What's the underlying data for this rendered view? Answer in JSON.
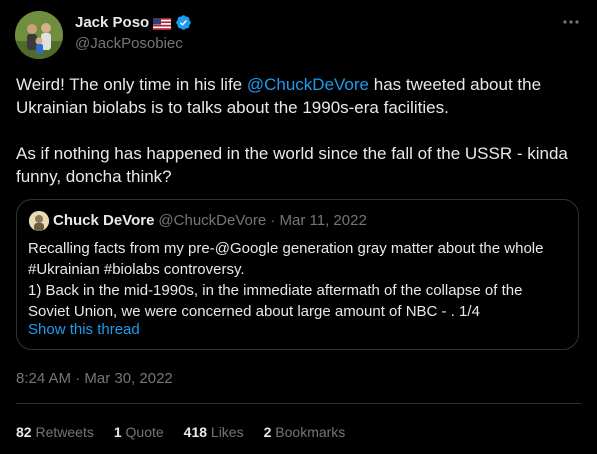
{
  "author": {
    "name": "Jack Poso",
    "handle": "@JackPosobiec"
  },
  "tweet": {
    "line1_pre": "Weird! The only time in his life ",
    "line1_mention": "@ChuckDeVore",
    "line1_post": " has tweeted about the Ukrainian biolabs is to talks about the 1990s-era facilities.",
    "para2": "As if nothing has happened in the world since the fall of the USSR - kinda funny, doncha think?"
  },
  "quote": {
    "name": "Chuck DeVore",
    "meta": "@ChuckDeVore · Mar 11, 2022",
    "lines": [
      "Recalling facts from my pre-@Google generation gray matter about the whole",
      "#Ukrainian #biolabs controversy.",
      "1) Back in the mid-1990s, in the immediate aftermath of the collapse of the",
      "Soviet Union, we were concerned about large amount of NBC - . 1/4"
    ],
    "show_thread": "Show this thread"
  },
  "timestamp": "8:24 AM · Mar 30, 2022",
  "stats": {
    "retweets_count": "82",
    "retweets_label": "Retweets",
    "quotes_count": "1",
    "quotes_label": "Quote",
    "likes_count": "418",
    "likes_label": "Likes",
    "bookmarks_count": "2",
    "bookmarks_label": "Bookmarks"
  },
  "icons": {
    "more": "more-icon",
    "verified": "verified-badge-icon",
    "flag": "us-flag-icon"
  },
  "colors": {
    "background": "#000000",
    "text": "#e7e9ea",
    "secondary": "#71767b",
    "accent": "#1d9bf0",
    "border": "#2f3336"
  }
}
